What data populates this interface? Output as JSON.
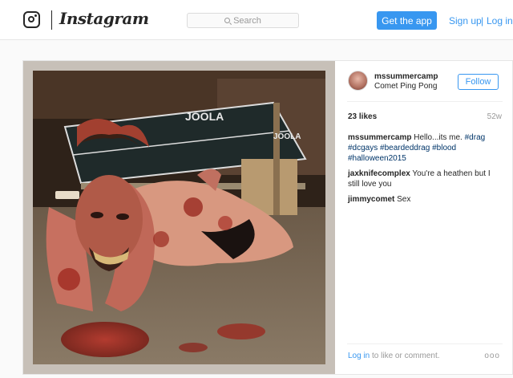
{
  "header": {
    "logo_text": "Instagram",
    "search_placeholder": "Search",
    "get_app_label": "Get the app",
    "signup_label": "Sign up",
    "separator": "|",
    "login_label": "Log in"
  },
  "post": {
    "username": "mssummercamp",
    "location": "Comet Ping Pong",
    "follow_label": "Follow",
    "likes": "23 likes",
    "age": "52w",
    "photo_text": {
      "brand": "JOOLA",
      "brand_side": "JOOLA"
    },
    "caption": {
      "user": "mssummercamp",
      "text": "Hello...its me.",
      "tags": [
        "#drag",
        "#dcgays",
        "#beardeddrag",
        "#blood",
        "#halloween2015"
      ]
    },
    "comments": [
      {
        "user": "jaxknifecomplex",
        "text": "You're a heathen but I still love you"
      },
      {
        "user": "jimmycomet",
        "text": "Sex"
      }
    ],
    "footer": {
      "login_link": "Log in",
      "login_suffix": "to like or comment.",
      "more_label": "ooo"
    }
  },
  "colors": {
    "accent": "#3897f0",
    "tag": "#003569",
    "muted": "#999999",
    "text": "#262626"
  },
  "icons": [
    "instagram-camera-icon",
    "search-icon",
    "more-options-icon"
  ]
}
